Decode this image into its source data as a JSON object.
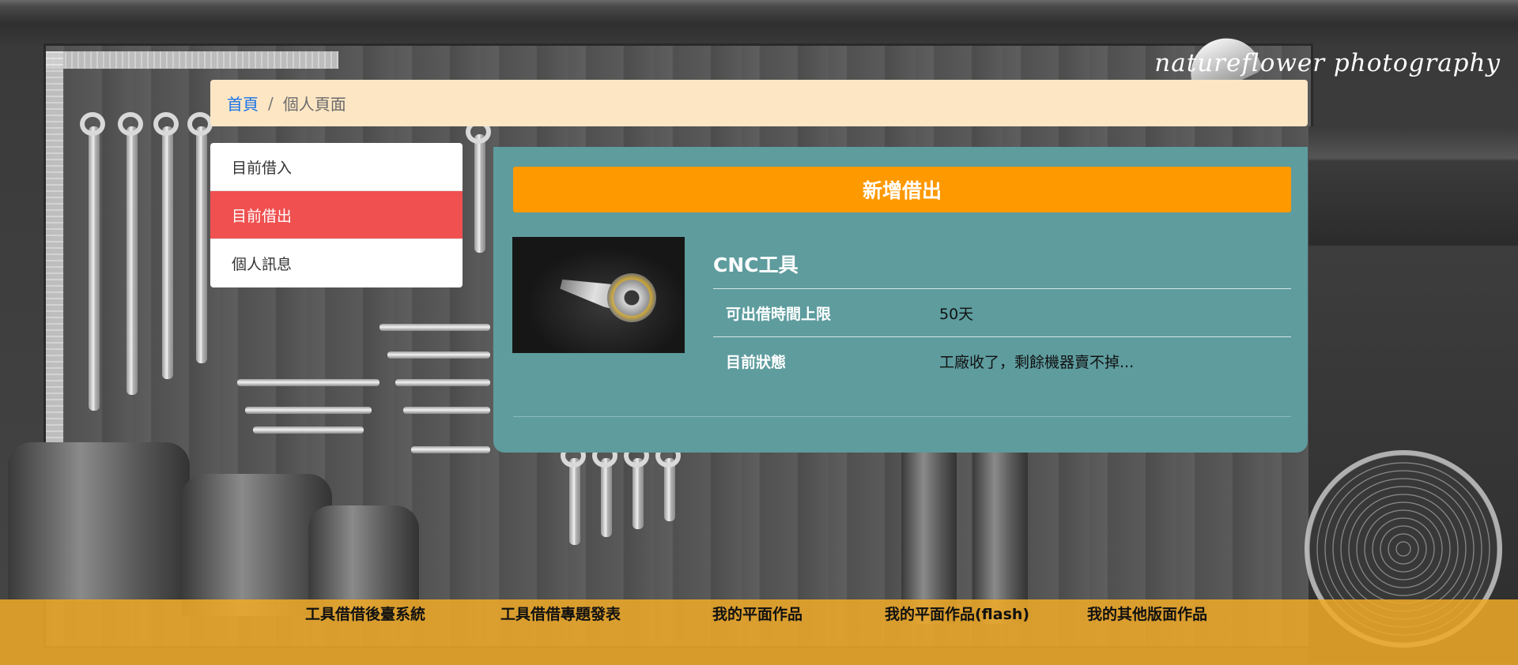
{
  "watermark": "natureflower photography",
  "breadcrumb": {
    "home": "首頁",
    "separator": "/",
    "current": "個人頁面"
  },
  "sidenav": {
    "items": [
      {
        "label": "目前借入",
        "active": false
      },
      {
        "label": "目前借出",
        "active": true
      },
      {
        "label": "個人訊息",
        "active": false
      }
    ]
  },
  "panel": {
    "add_button": "新增借出",
    "tool": {
      "name": "CNC工具",
      "rows": [
        {
          "key": "可出借時間上限",
          "value": "50天"
        },
        {
          "key": "目前狀態",
          "value": "工廠收了，剩餘機器賣不掉..."
        }
      ]
    }
  },
  "footer": {
    "links": [
      "工具借借後臺系統",
      "工具借借專題發表",
      "我的平面作品",
      "我的平面作品(flash)",
      "我的其他版面作品"
    ]
  },
  "colors": {
    "accent_orange": "#ff9900",
    "active_red": "#f05050",
    "panel_teal": "#5e9c9e",
    "breadcrumb_bg": "#fce6c4",
    "footer_bg": "#f0aa28"
  }
}
